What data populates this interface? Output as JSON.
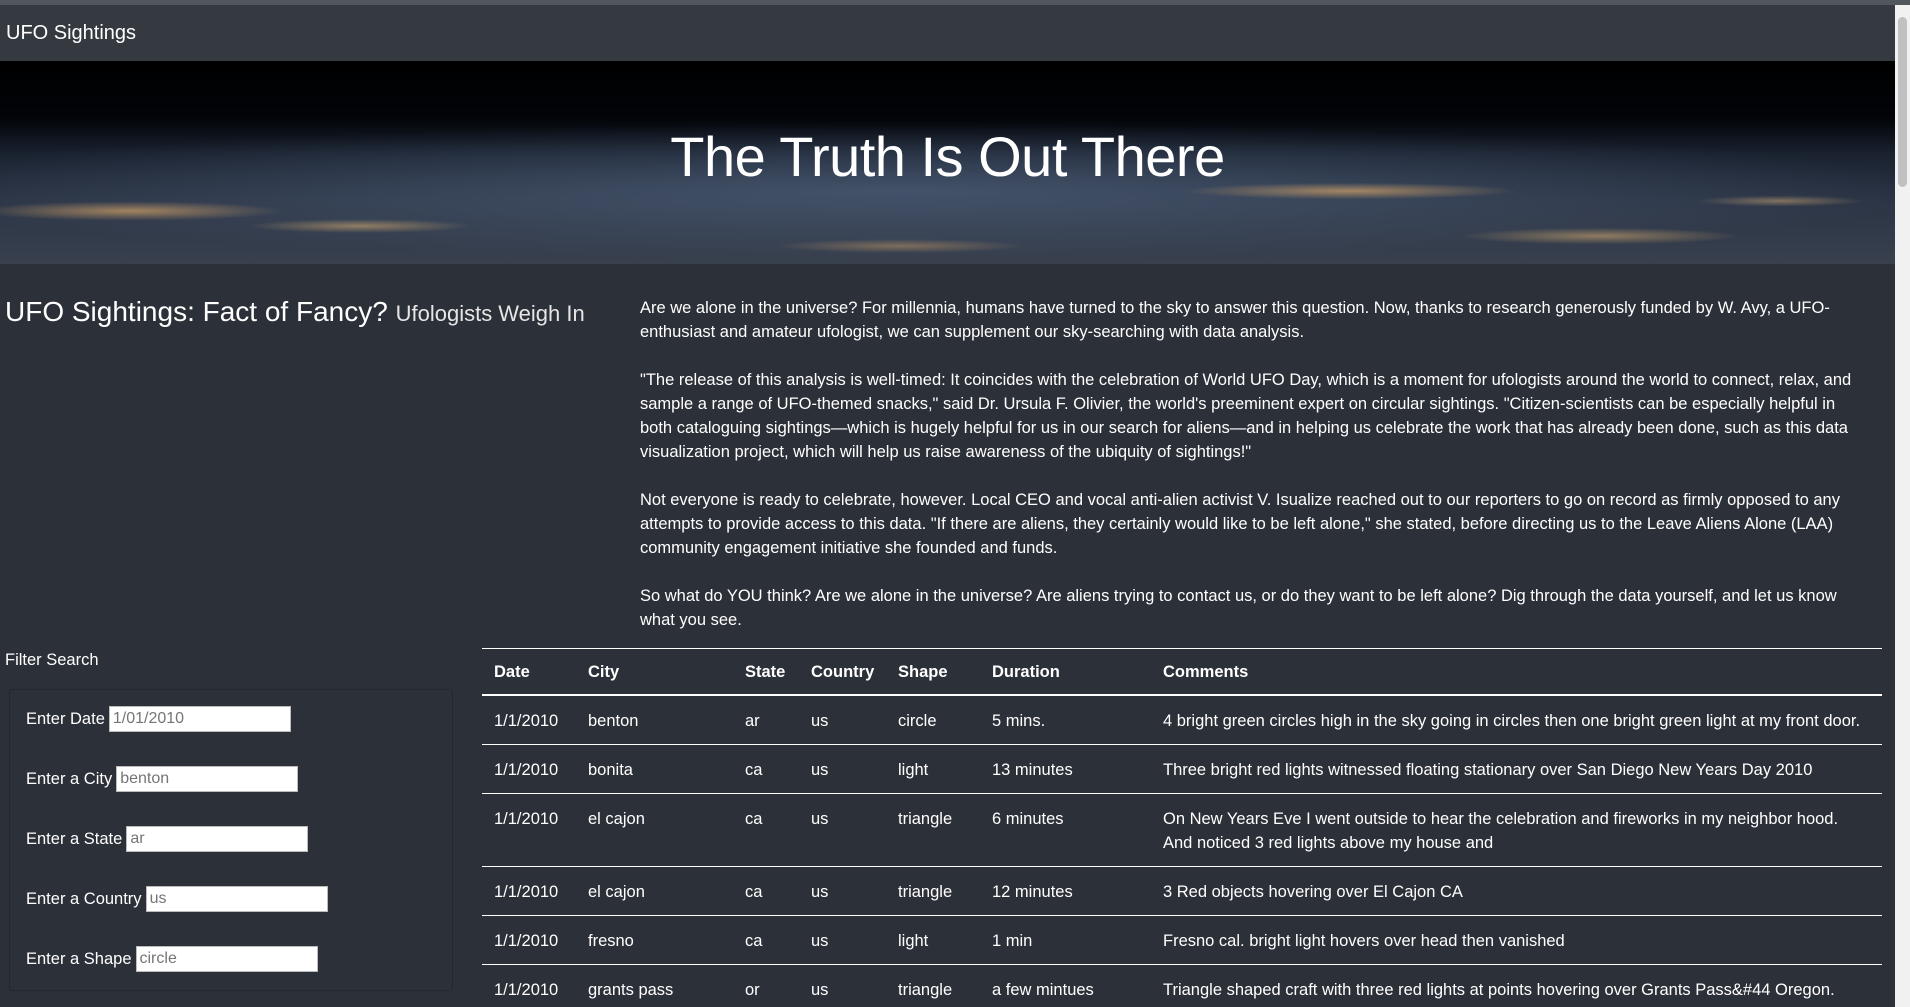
{
  "navbar": {
    "brand": "UFO Sightings"
  },
  "hero": {
    "title": "The Truth Is Out There"
  },
  "article": {
    "heading": "UFO Sightings: Fact of Fancy?",
    "subheading": "Ufologists Weigh In",
    "paragraphs": [
      "Are we alone in the universe? For millennia, humans have turned to the sky to answer this question. Now, thanks to research generously funded by W. Avy, a UFO-enthusiast and amateur ufologist, we can supplement our sky-searching with data analysis.",
      "\"The release of this analysis is well-timed: It coincides with the celebration of World UFO Day, which is a moment for ufologists around the world to connect, relax, and sample a range of UFO-themed snacks,\" said Dr. Ursula F. Olivier, the world's preeminent expert on circular sightings. \"Citizen-scientists can be especially helpful in both cataloguing sightings—which is hugely helpful for us in our search for aliens—and in helping us celebrate the work that has already been done, such as this data visualization project, which will help us raise awareness of the ubiquity of sightings!\"",
      "Not everyone is ready to celebrate, however. Local CEO and vocal anti-alien activist V. Isualize reached out to our reporters to go on record as firmly opposed to any attempts to provide access to this data. \"If there are aliens, they certainly would like to be left alone,\" she stated, before directing us to the Leave Aliens Alone (LAA) community engagement initiative she founded and funds.",
      "So what do YOU think? Are we alone in the universe? Are aliens trying to contact us, or do they want to be left alone? Dig through the data yourself, and let us know what you see."
    ]
  },
  "filters": {
    "title": "Filter Search",
    "fields": [
      {
        "label": "Enter Date",
        "value": "1/01/2010"
      },
      {
        "label": "Enter a City",
        "value": "benton"
      },
      {
        "label": "Enter a State",
        "value": "ar"
      },
      {
        "label": "Enter a Country",
        "value": "us"
      },
      {
        "label": "Enter a Shape",
        "value": "circle"
      }
    ]
  },
  "table": {
    "headers": [
      "Date",
      "City",
      "State",
      "Country",
      "Shape",
      "Duration",
      "Comments"
    ],
    "rows": [
      [
        "1/1/2010",
        "benton",
        "ar",
        "us",
        "circle",
        "5 mins.",
        "4 bright green circles high in the sky going in circles then one bright green light at my front door."
      ],
      [
        "1/1/2010",
        "bonita",
        "ca",
        "us",
        "light",
        "13 minutes",
        "Three bright red lights witnessed floating stationary over San Diego New Years Day 2010"
      ],
      [
        "1/1/2010",
        "el cajon",
        "ca",
        "us",
        "triangle",
        "6 minutes",
        "On New Years Eve I went outside to hear the celebration and fireworks in my neighbor hood. And noticed 3 red lights above my house and"
      ],
      [
        "1/1/2010",
        "el cajon",
        "ca",
        "us",
        "triangle",
        "12 minutes",
        "3 Red objects hovering over El Cajon CA"
      ],
      [
        "1/1/2010",
        "fresno",
        "ca",
        "us",
        "light",
        "1 min",
        "Fresno cal. bright light hovers over head then vanished"
      ],
      [
        "1/1/2010",
        "grants pass",
        "or",
        "us",
        "triangle",
        "a few mintues",
        "Triangle shaped craft with three red lights at points hovering over Grants Pass&#44 Oregon."
      ]
    ]
  }
}
